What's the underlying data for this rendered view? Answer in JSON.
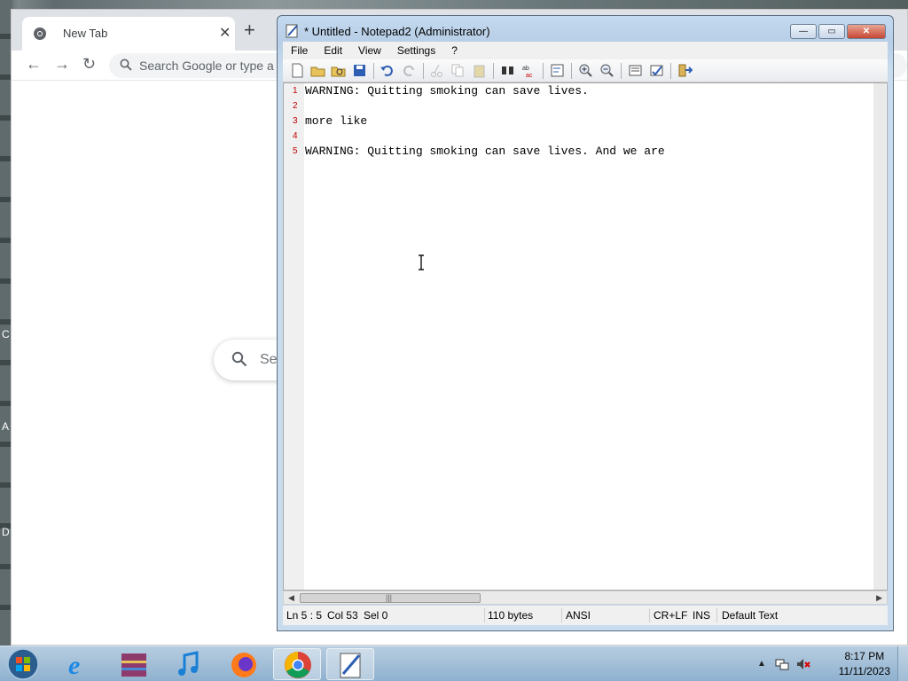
{
  "desktop": {
    "letters": [
      "C",
      "A",
      "D"
    ]
  },
  "chrome": {
    "tab_title": "New Tab",
    "tab_close": "✕",
    "new_tab": "+",
    "omnibox_placeholder": "Search Google or type a URL",
    "search_placeholder": "Se"
  },
  "notepad": {
    "title": "* Untitled - Notepad2 (Administrator)",
    "controls": {
      "minimize": "—",
      "maximize": "▭",
      "close": "✕"
    },
    "menu": [
      "File",
      "Edit",
      "View",
      "Settings",
      "?"
    ],
    "lines": [
      {
        "num": "1",
        "text": "WARNING: Quitting smoking can save lives."
      },
      {
        "num": "2",
        "text": ""
      },
      {
        "num": "3",
        "text": "more like"
      },
      {
        "num": "4",
        "text": ""
      },
      {
        "num": "5",
        "text": "WARNING: Quitting smoking can save lives. And we are"
      }
    ],
    "status": {
      "position": "Ln 5 : 5",
      "column": "Col 53",
      "selection": "Sel 0",
      "size": "110 bytes",
      "encoding": "ANSI",
      "line_endings": "CR+LF",
      "insert_mode": "INS",
      "scheme": "Default Text"
    }
  },
  "taskbar": {
    "time": "8:17 PM",
    "date": "11/11/2023",
    "tray_arrow": "▲"
  },
  "colors": {
    "line_number": "#c00000",
    "notepad_frame": "#bcd3ea",
    "chrome_tabstrip": "#dee1e6"
  }
}
